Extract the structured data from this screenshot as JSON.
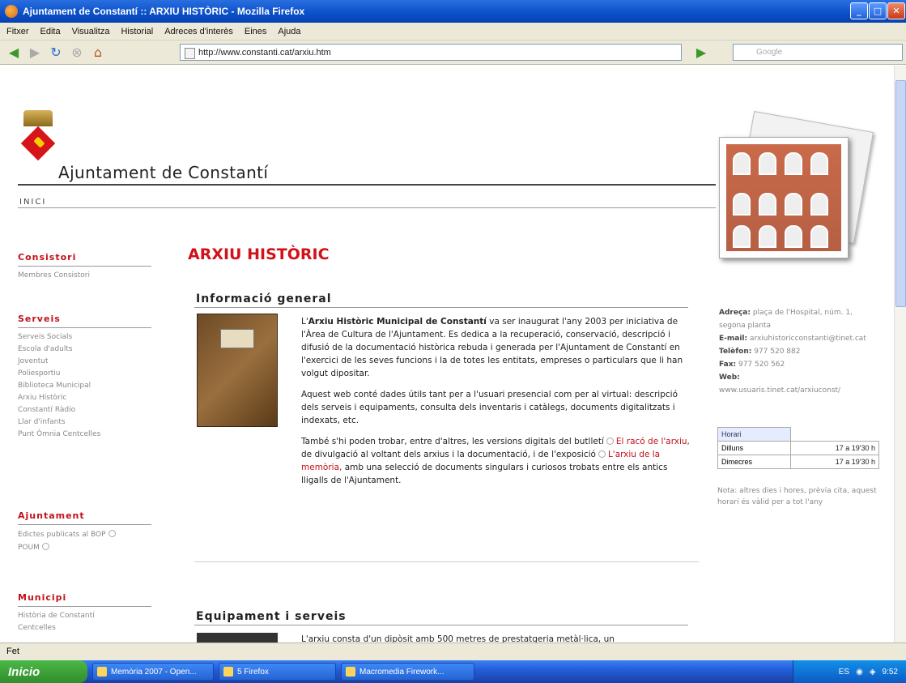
{
  "window": {
    "title": "Ajuntament de Constantí :: ARXIU HISTÒRIC - Mozilla Firefox"
  },
  "menu": [
    "Fitxer",
    "Edita",
    "Visualitza",
    "Historial",
    "Adreces d'interès",
    "Eines",
    "Ajuda"
  ],
  "toolbar": {
    "url": "http://www.constanti.cat/arxiu.htm",
    "search_placeholder": "Google"
  },
  "site": {
    "title": "Ajuntament de Constantí",
    "nav_home": "INICI"
  },
  "sidebar": {
    "sections": [
      {
        "heading": "Consistori",
        "items": [
          "Membres Consistori"
        ]
      },
      {
        "heading": "Serveis",
        "items": [
          "Serveis Socials",
          "Escola d'adults",
          "Joventut",
          "Poliesportiu",
          "Biblioteca Municipal",
          "Arxiu Històric",
          "Constantí Ràdio",
          "Llar d'infants",
          "Punt Òmnia Centcelles"
        ]
      },
      {
        "heading": "Ajuntament",
        "items": [
          "Edictes publicats al BOP",
          "POUM"
        ]
      },
      {
        "heading": "Municipi",
        "items": [
          "Història de Constantí",
          "Centcelles"
        ]
      }
    ]
  },
  "main": {
    "heading": "ARXIU HISTÒRIC",
    "section1_title": "Informació general",
    "p1_prefix": "L'",
    "p1_bold": "Arxiu Històric Municipal de Constantí",
    "p1_rest": " va ser inaugurat l'any 2003 per iniciativa de l'Àrea de Cultura de l'Ajuntament. Es dedica a la recuperació, conservació, descripció i difusió de la documentació històrica rebuda i generada per l'Ajuntament de Constantí en l'exercici de les seves funcions i la de totes les entitats, empreses o particulars que li han volgut dipositar.",
    "p2": "Aquest web conté dades útils tant per a l'usuari presencial com per al virtual: descripció dels serveis i equipaments, consulta dels inventaris i catàlegs, documents digitalitzats i indexats, etc.",
    "p3_a": "També s'hi poden trobar, entre d'altres, les versions digitals del butlletí",
    "p3_link1": "El racó de l'arxiu,",
    "p3_b": " de divulgació al voltant dels arxius i la documentació, i de l'exposició",
    "p3_link2": "L'arxiu de la memòria,",
    "p3_c": " amb una selecció de documents singulars i curiosos trobats entre els antics lligalls de l'Ajuntament.",
    "section2_title": "Equipament i serveis",
    "section2_text": "L'arxiu consta d'un dipòsit amb 500 metres de prestatgeria metàl·lica, un"
  },
  "contact": {
    "address_label": "Adreça:",
    "address": "plaça de l'Hospital, núm. 1, segona planta",
    "email_label": "E-mail:",
    "email": "arxiuhistoricconstanti@tinet.cat",
    "phone_label": "Telèfon:",
    "phone": "977 520 882",
    "fax_label": "Fax:",
    "fax": "977 520 562",
    "web_label": "Web:",
    "web": "www.usuaris.tinet.cat/arxiuconst/"
  },
  "schedule": {
    "header": "Horari",
    "rows": [
      {
        "day": "Dilluns",
        "hours": "17 a 19'30 h"
      },
      {
        "day": "Dimecres",
        "hours": "17 a 19'30 h"
      }
    ]
  },
  "note": "Nota: altres dies i hores, prèvia cita, aquest horari és vàlid per a tot l'any",
  "status": {
    "text": "Fet"
  },
  "taskbar": {
    "start": "Inicio",
    "buttons": [
      "Memòria 2007 - Open...",
      "5 Firefox",
      "Macromedia Firework..."
    ],
    "tray_lang": "ES",
    "clock": "9:52"
  },
  "colors": {
    "accent": "#c0121b",
    "titlebar": "#0a4fc8"
  }
}
